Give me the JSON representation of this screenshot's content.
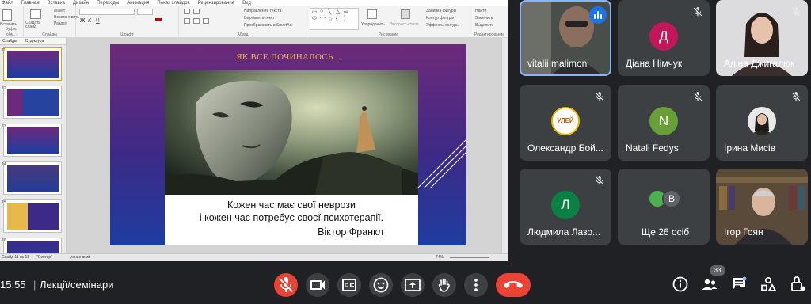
{
  "powerpoint": {
    "tabs": [
      "Файл",
      "Главная",
      "Вставка",
      "Дизайн",
      "Переходы",
      "Анимация",
      "Показ слайдов",
      "Рецензирование",
      "Вид"
    ],
    "groups": {
      "clipboard": "Буфер обм...",
      "slides": "Слайды",
      "font": "Шрифт",
      "paragraph": "Абзац",
      "drawing": "Рисование",
      "editing": "Редактирование"
    },
    "ribbon_labels": {
      "paste": "Вставить",
      "create_slide": "Создать слайд",
      "layout": "Макет",
      "reset": "Восстановить",
      "section": "Раздел",
      "text_direction": "Направление текста",
      "align_text": "Выровнять текст",
      "convert_smartart": "Преобразовать в SmartArt",
      "arrange": "Упорядочить",
      "quick_styles": "Экспресс-стили",
      "shape_fill": "Заливка фигуры",
      "shape_outline": "Контур фигуры",
      "shape_effects": "Эффекты фигуры",
      "find": "Найти",
      "replace": "Заменить",
      "select": "Выделить"
    },
    "pane_tabs": [
      "Слайды",
      "Структура"
    ],
    "thumb_numbers": [
      "11",
      "12",
      "13",
      "14",
      "15",
      "16"
    ],
    "status_left": "Слайд 11 из 18",
    "status_theme": "\"Сектор\"",
    "status_lang": "украинский",
    "zoom": "74%",
    "slide": {
      "title": "ЯК ВСЕ ПОЧИНАЛОСЬ...",
      "quote_line1": "Кожен час має свої неврози",
      "quote_line2": "і кожен час потребує своєї психотерапії.",
      "author": "Віктор Франкл"
    }
  },
  "participants": [
    {
      "name": "vitalii malimon",
      "type": "video",
      "speaking": true
    },
    {
      "name": "Діана Німчук",
      "type": "avatar",
      "initial": "Д",
      "color": "#c2185b",
      "muted": true
    },
    {
      "name": "Аліна Джигалюк",
      "type": "video",
      "muted": true
    },
    {
      "name": "Олександр Бой...",
      "type": "logo",
      "logo_text": "УЛЕЙ",
      "muted": true
    },
    {
      "name": "Natali Fedys",
      "type": "avatar",
      "initial": "N",
      "color": "#689f38",
      "muted": true
    },
    {
      "name": "Ірина Мисів",
      "type": "photo",
      "muted": true
    },
    {
      "name": "Людмила Лазо...",
      "type": "avatar",
      "initial": "Л",
      "color": "#0b8043",
      "muted": true
    },
    {
      "name": "Ще 26 осіб",
      "type": "group",
      "initial": "В"
    },
    {
      "name": "Ігор Гоян",
      "type": "video",
      "muted": true
    }
  ],
  "bottom_bar": {
    "time": "15:55",
    "separator": "|",
    "meeting_title": "Лекції/семінари",
    "participant_count": "33",
    "controls": [
      "mic-off-icon",
      "camera-icon",
      "captions-icon",
      "emoji-icon",
      "present-icon",
      "raise-hand-icon",
      "more-options-icon",
      "hang-up-icon"
    ],
    "right_icons": [
      "info-icon",
      "people-icon",
      "chat-icon",
      "activities-icon",
      "host-controls-icon"
    ]
  },
  "colors": {
    "meet_bg": "#202124",
    "tile_bg": "#3c4043",
    "hangup_red": "#ea4335",
    "speaking_outline": "#8ab4f8",
    "slide_title": "#e8b84a"
  }
}
